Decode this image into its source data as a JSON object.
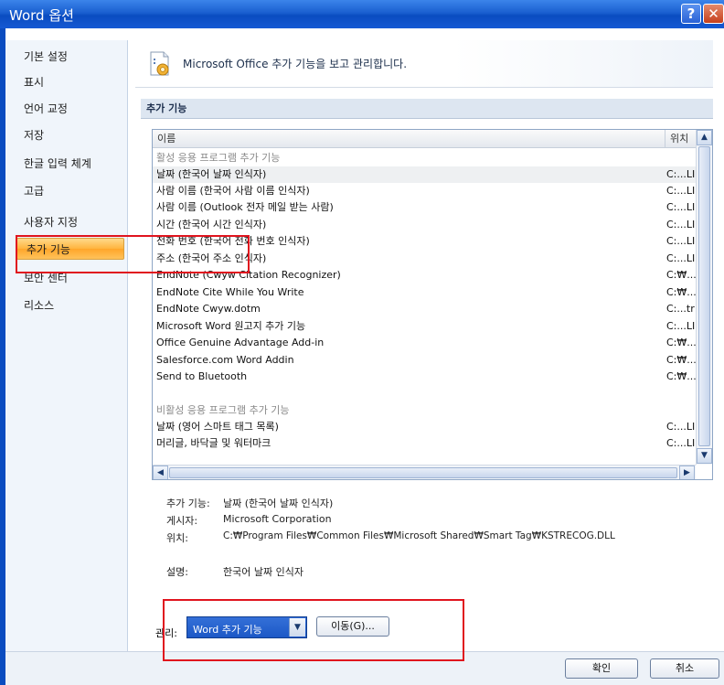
{
  "window": {
    "title": "Word 옵션"
  },
  "sidebar": {
    "items": [
      {
        "label": "기본 설정"
      },
      {
        "label": "표시"
      },
      {
        "label": "언어 교정"
      },
      {
        "label": "저장"
      },
      {
        "label": "한글 입력 체계"
      },
      {
        "label": "고급"
      },
      {
        "label": "사용자 지정"
      },
      {
        "label": "추가 기능"
      },
      {
        "label": "보안 센터"
      },
      {
        "label": "리소스"
      }
    ]
  },
  "header": {
    "text": "Microsoft Office 추가 기능을 보고 관리합니다."
  },
  "section": {
    "title": "추가 기능"
  },
  "list": {
    "columns": {
      "name": "이름",
      "location": "위치"
    },
    "rows": [
      {
        "name": "활성 응용 프로그램 추가 기능",
        "location": ""
      },
      {
        "name": "날짜 (한국어 날짜 인식자)",
        "location": "C:...LI"
      },
      {
        "name": "사람 이름 (한국어 사람 이름 인식자)",
        "location": "C:...LI"
      },
      {
        "name": "사람 이름 (Outlook 전자 메일 받는 사람)",
        "location": "C:...LI"
      },
      {
        "name": "시간 (한국어 시간 인식자)",
        "location": "C:...LI"
      },
      {
        "name": "전화 번호 (한국어 전화 번호 인식자)",
        "location": "C:...LI"
      },
      {
        "name": "주소 (한국어 주소 인식자)",
        "location": "C:...LI"
      },
      {
        "name": "EndNote (Cwyw Citation Recognizer)",
        "location": "C:₩..."
      },
      {
        "name": "EndNote Cite While You Write",
        "location": "C:₩..."
      },
      {
        "name": "EndNote Cwyw.dotm",
        "location": "C:...tr"
      },
      {
        "name": "Microsoft Word 원고지 추가 기능",
        "location": "C:...LI"
      },
      {
        "name": "Office Genuine Advantage Add-in",
        "location": "C:₩..."
      },
      {
        "name": "Salesforce.com Word Addin",
        "location": "C:₩..."
      },
      {
        "name": "Send to Bluetooth",
        "location": "C:₩..."
      },
      {
        "name": "",
        "location": ""
      },
      {
        "name": "비활성 응용 프로그램 추가 기능",
        "location": ""
      },
      {
        "name": "날짜 (영어 스마트 태그 목록)",
        "location": "C:...LI"
      },
      {
        "name": "머리글, 바닥글 및 워터마크",
        "location": "C:...LI"
      }
    ]
  },
  "details": {
    "addin_label": "추가 기능:",
    "addin_value": "날짜 (한국어 날짜 인식자)",
    "publisher_label": "게시자:",
    "publisher_value": "Microsoft Corporation",
    "location_label": "위치:",
    "location_value": "C:₩Program Files₩Common Files₩Microsoft Shared₩Smart Tag₩KSTRECOG.DLL",
    "description_label": "설명:",
    "description_value": "한국어 날짜 인식자"
  },
  "manage": {
    "label": "관리:",
    "selected": "Word 추가 기능",
    "go_button": "이동(G)..."
  },
  "footer": {
    "ok": "확인",
    "cancel": "취소"
  }
}
